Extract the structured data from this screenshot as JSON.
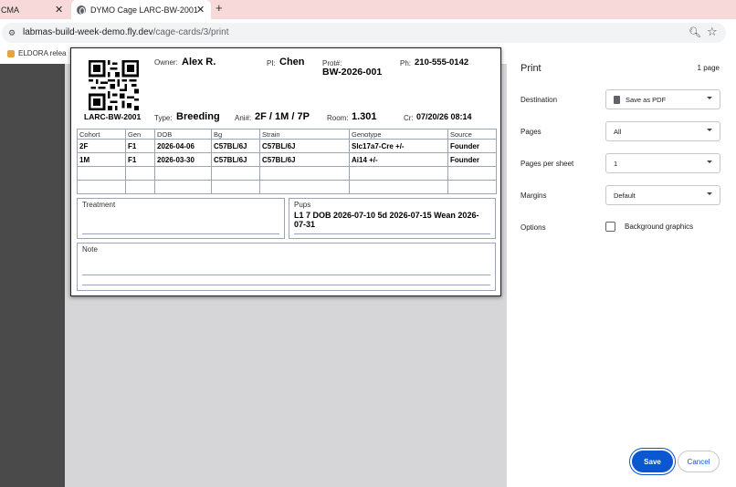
{
  "tabs": [
    {
      "title": "CMA",
      "close": "✕"
    },
    {
      "title": "DYMO Cage LARC-BW-2001 - ",
      "close": "✕"
    }
  ],
  "new_tab": "+",
  "address": {
    "host": "labmas-build-week-demo.fly.dev",
    "path": "/cage-cards/3/print"
  },
  "bookmarks": [
    {
      "label": "ELDORA relea"
    }
  ],
  "card": {
    "cage_id": "LARC-BW-2001",
    "owner_label": "Owner:",
    "owner": "Alex R.",
    "pi_label": "PI:",
    "pi": "Chen",
    "prot_label": "Prot#:",
    "prot": "BW-2026-001",
    "ph_label": "Ph:",
    "ph": "210-555-0142",
    "type_label": "Type:",
    "type": "Breeding",
    "ani_label": "Ani#:",
    "ani": "2F / 1M / 7P",
    "room_label": "Room:",
    "room": "1.301",
    "cr_label": "Cr:",
    "cr": "07/20/26 08:14",
    "table": {
      "headers": [
        "Cohort",
        "Gen",
        "DOB",
        "Bg",
        "Strain",
        "Genotype",
        "Source"
      ],
      "rows": [
        [
          "2F",
          "F1",
          "2026-04-06",
          "C57BL/6J",
          "C57BL/6J",
          "Slc17a7-Cre +/-",
          "Founder"
        ],
        [
          "1M",
          "F1",
          "2026-03-30",
          "C57BL/6J",
          "C57BL/6J",
          "Ai14 +/-",
          "Founder"
        ],
        [
          "",
          "",
          "",
          "",
          "",
          "",
          ""
        ],
        [
          "",
          "",
          "",
          "",
          "",
          "",
          ""
        ]
      ]
    },
    "treatment_label": "Treatment",
    "pups_label": "Pups",
    "pups": "L1 7 DOB 2026-07-10 5d 2026-07-15 Wean 2026-07-31",
    "note_label": "Note"
  },
  "print": {
    "title": "Print",
    "page_count": "1 page",
    "options": [
      {
        "label": "Destination",
        "value": "Save as PDF"
      },
      {
        "label": "Pages",
        "value": "All"
      },
      {
        "label": "Pages per sheet",
        "value": "1"
      },
      {
        "label": "Margins",
        "value": "Default"
      }
    ],
    "options_label": "Options",
    "background_graphics": "Background graphics",
    "background_graphics_checked": false,
    "save": "Save",
    "cancel": "Cancel"
  }
}
